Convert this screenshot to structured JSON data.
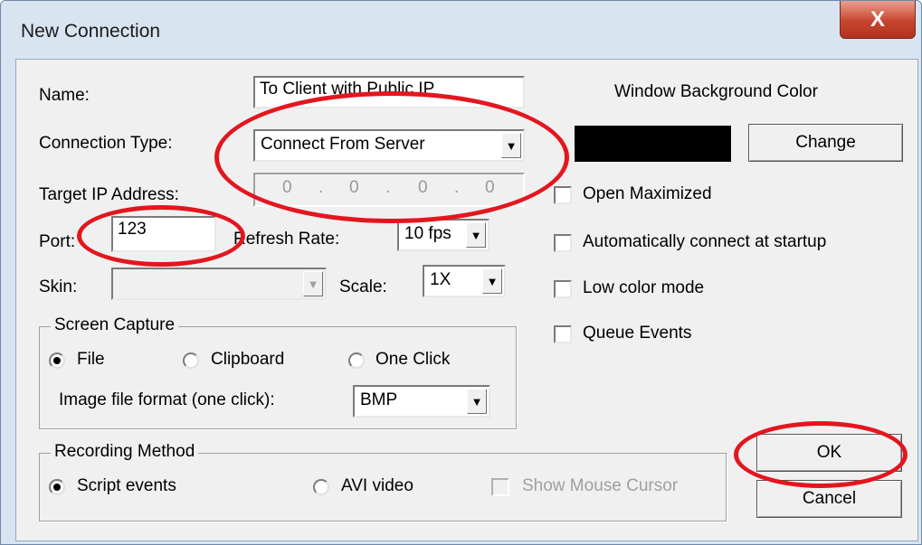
{
  "window": {
    "title": "New Connection",
    "close_label": "X"
  },
  "fields": {
    "name_label": "Name:",
    "name_value": "To Client with Public IP",
    "connection_type_label": "Connection Type:",
    "connection_type_value": "Connect From Server",
    "target_ip_label": "Target IP Address:",
    "target_ip_octets": [
      "0",
      "0",
      "0",
      "0"
    ],
    "port_label": "Port:",
    "port_value": "123",
    "refresh_label": "Refresh Rate:",
    "refresh_value": "10 fps",
    "skin_label": "Skin:",
    "skin_value": "",
    "scale_label": "Scale:",
    "scale_value": "1X"
  },
  "right_panel": {
    "bg_color_label": "Window Background Color",
    "bg_color": "#000000",
    "change_label": "Change",
    "options": [
      {
        "label": "Open Maximized",
        "checked": false
      },
      {
        "label": "Automatically connect at startup",
        "checked": false
      },
      {
        "label": "Low color mode",
        "checked": false
      },
      {
        "label": "Queue Events",
        "checked": false
      }
    ]
  },
  "screen_capture": {
    "title": "Screen Capture",
    "options": [
      {
        "label": "File",
        "selected": true
      },
      {
        "label": "Clipboard",
        "selected": false
      },
      {
        "label": "One Click",
        "selected": false
      }
    ],
    "format_label": "Image file format (one click):",
    "format_value": "BMP"
  },
  "recording": {
    "title": "Recording Method",
    "options": [
      {
        "label": "Script events",
        "selected": true
      },
      {
        "label": "AVI video",
        "selected": false
      }
    ],
    "show_cursor_label": "Show Mouse Cursor",
    "show_cursor_enabled": false
  },
  "buttons": {
    "ok": "OK",
    "cancel": "Cancel"
  },
  "annotation_color": "#e3161f"
}
